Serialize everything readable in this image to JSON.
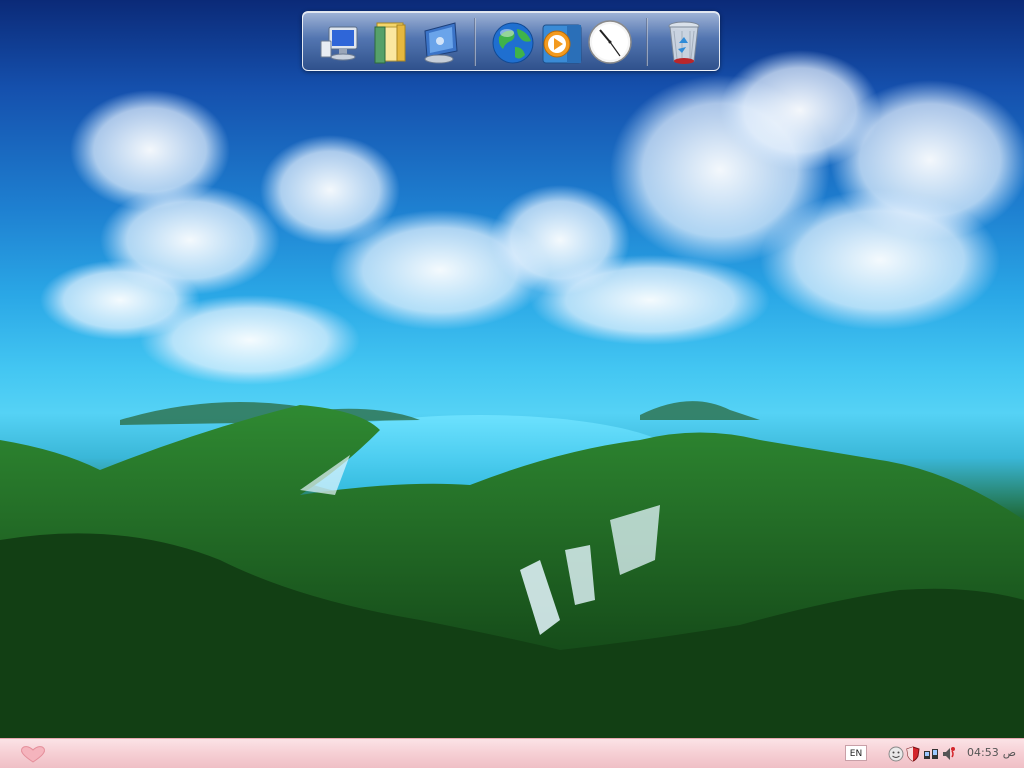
{
  "dock": {
    "items": [
      {
        "name": "my-computer-icon"
      },
      {
        "name": "documents-folder-icon"
      },
      {
        "name": "control-panel-icon"
      },
      {
        "name": "internet-globe-icon"
      },
      {
        "name": "media-player-icon"
      },
      {
        "name": "clock-icon"
      },
      {
        "name": "recycle-bin-icon"
      }
    ]
  },
  "taskbar": {
    "language": "EN",
    "time": "04:53",
    "ampm": "ص"
  },
  "colors": {
    "taskbar": "#f6cfd4",
    "dock_frame": "#7896c3"
  }
}
